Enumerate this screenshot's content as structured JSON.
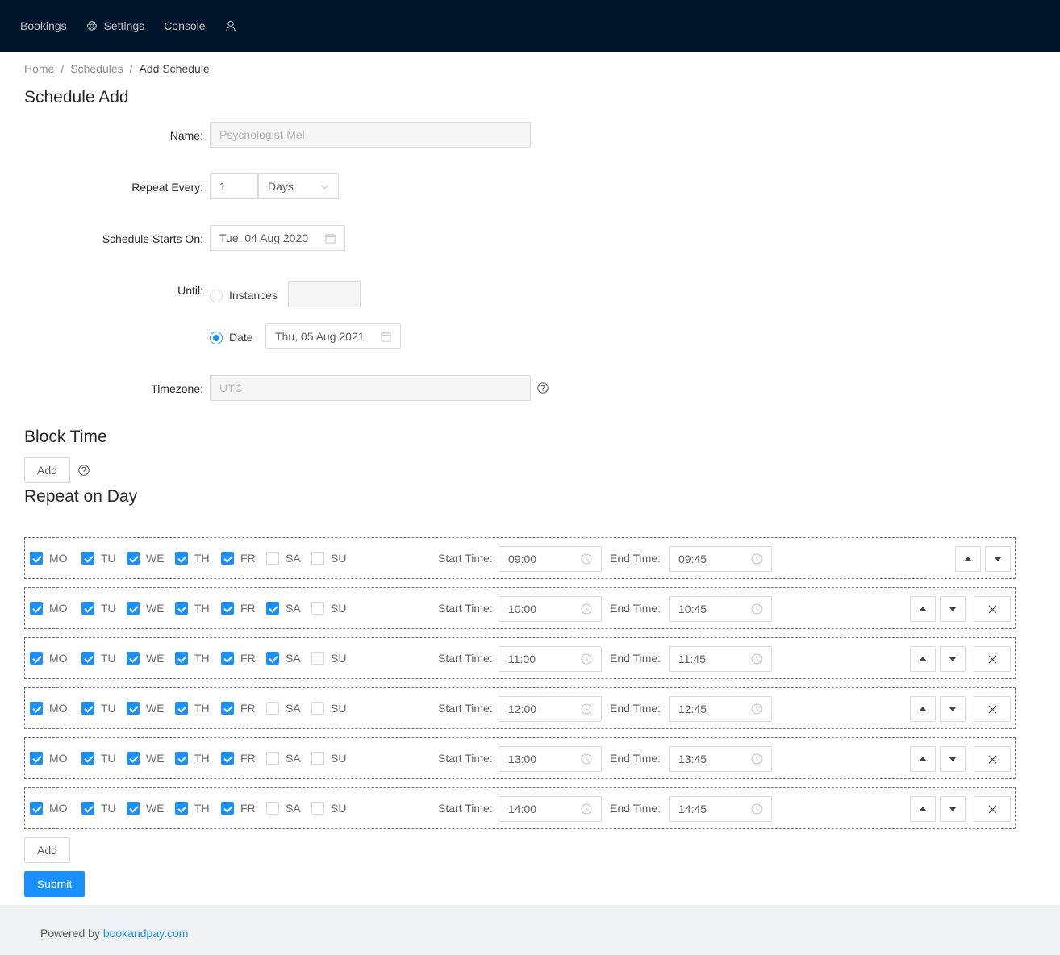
{
  "nav": {
    "items": [
      {
        "label": "Bookings",
        "icon": null
      },
      {
        "label": "Settings",
        "icon": "gear-icon"
      },
      {
        "label": "Console",
        "icon": null
      }
    ],
    "user_icon": "user-icon"
  },
  "breadcrumb": {
    "items": [
      "Home",
      "Schedules",
      "Add Schedule"
    ],
    "separator": "/"
  },
  "page_title": "Schedule Add",
  "form": {
    "name": {
      "label": "Name",
      "value": "Psychologist-Mel",
      "disabled": true
    },
    "repeat_every": {
      "label": "Repeat Every",
      "value": "1",
      "unit": "Days"
    },
    "starts_on": {
      "label": "Schedule Starts On",
      "value": "Tue, 04 Aug 2020"
    },
    "until": {
      "label": "Until",
      "instances_label": "Instances",
      "instances_value": "",
      "date_label": "Date",
      "date_value": "Thu, 05 Aug 2021",
      "selected": "date"
    },
    "timezone": {
      "label": "Timezone",
      "value": "UTC",
      "disabled": true
    }
  },
  "block_time": {
    "title": "Block Time",
    "add_label": "Add"
  },
  "repeat_on_day": {
    "title": "Repeat on Day",
    "day_labels": [
      "MO",
      "TU",
      "WE",
      "TH",
      "FR",
      "SA",
      "SU"
    ],
    "start_label": "Start Time:",
    "end_label": "End Time:",
    "rows": [
      {
        "days": [
          true,
          true,
          true,
          true,
          true,
          false,
          false
        ],
        "start": "09:00",
        "end": "09:45",
        "removable": false
      },
      {
        "days": [
          true,
          true,
          true,
          true,
          true,
          true,
          false
        ],
        "start": "10:00",
        "end": "10:45",
        "removable": true
      },
      {
        "days": [
          true,
          true,
          true,
          true,
          true,
          true,
          false
        ],
        "start": "11:00",
        "end": "11:45",
        "removable": true
      },
      {
        "days": [
          true,
          true,
          true,
          true,
          true,
          false,
          false
        ],
        "start": "12:00",
        "end": "12:45",
        "removable": true
      },
      {
        "days": [
          true,
          true,
          true,
          true,
          true,
          false,
          false
        ],
        "start": "13:00",
        "end": "13:45",
        "removable": true
      },
      {
        "days": [
          true,
          true,
          true,
          true,
          true,
          false,
          false
        ],
        "start": "14:00",
        "end": "14:45",
        "removable": true
      }
    ],
    "add_label": "Add"
  },
  "submit_label": "Submit",
  "footer": {
    "prefix": "Powered by ",
    "link_text": "bookandpay.com"
  },
  "colors": {
    "nav_bg": "#001529",
    "primary": "#1890ff",
    "footer_bg": "#f0f2f5"
  }
}
